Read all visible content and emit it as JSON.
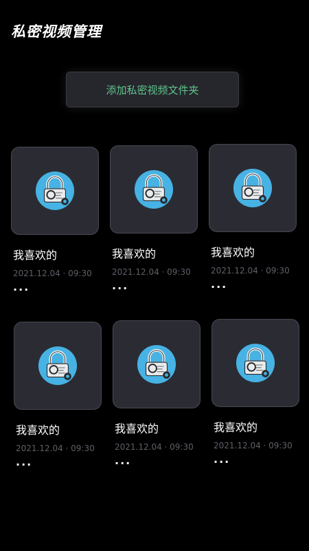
{
  "header": {
    "title": "私密视频管理"
  },
  "actions": {
    "add_folder_label": "添加私密视频文件夹"
  },
  "folders": [
    {
      "name": "我喜欢的",
      "date": "2021.12.04 · 09:30",
      "more": "···"
    },
    {
      "name": "我喜欢的",
      "date": "2021.12.04 · 09:30",
      "more": "···"
    },
    {
      "name": "我喜欢的",
      "date": "2021.12.04 · 09:30",
      "more": "···"
    },
    {
      "name": "我喜欢的",
      "date": "2021.12.04 · 09:30",
      "more": "···"
    },
    {
      "name": "我喜欢的",
      "date": "2021.12.04 · 09:30",
      "more": "···"
    },
    {
      "name": "我喜欢的",
      "date": "2021.12.04 · 09:30",
      "more": "···"
    }
  ],
  "colors": {
    "background": "#000000",
    "card": "#2b2c33",
    "accent_text": "#5ec48a",
    "icon_circle": "#47b2e4",
    "muted_text": "#5f6068"
  },
  "icons": {
    "folder_thumbnail": "lock-icon",
    "more": "more-icon"
  }
}
